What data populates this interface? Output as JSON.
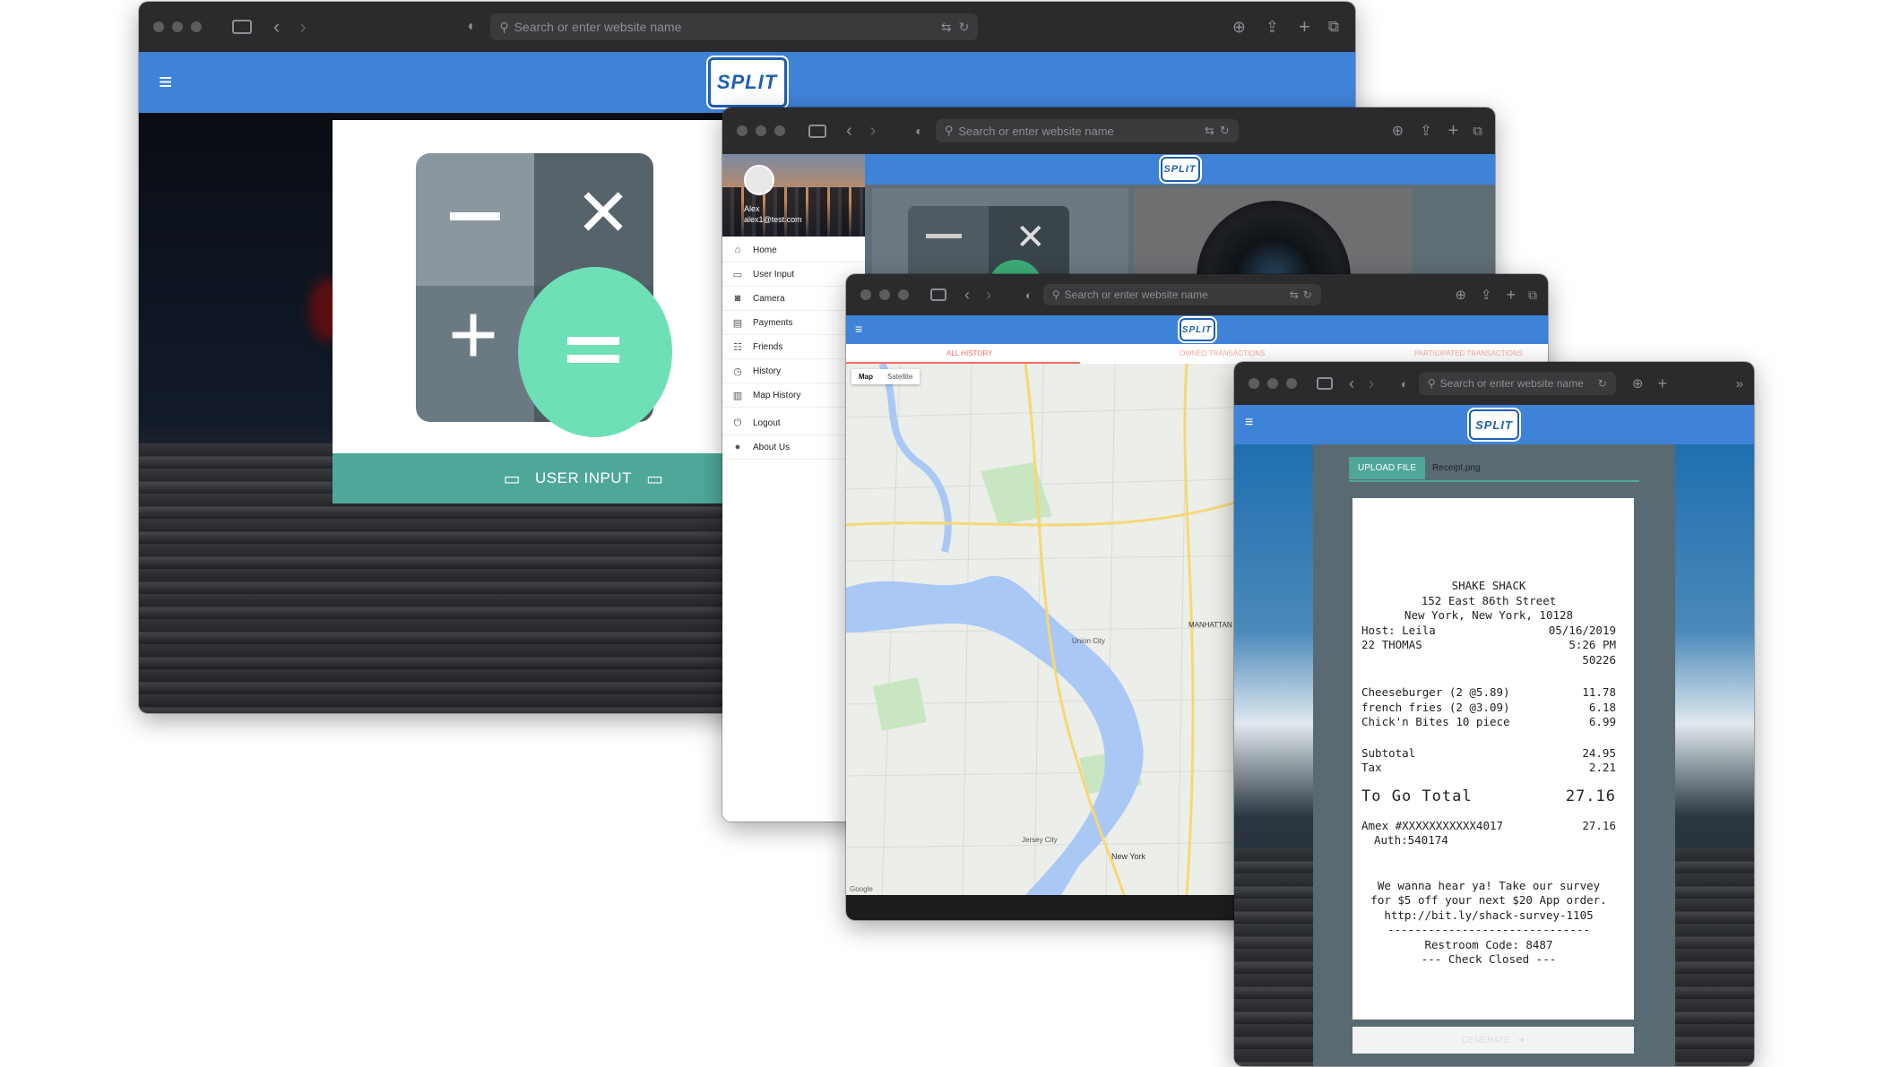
{
  "browser": {
    "url_placeholder": "Search or enter website name"
  },
  "app": {
    "logo_text": "SPLIT"
  },
  "window1": {
    "card_label": "USER INPUT",
    "card_label_icon_left": "laptop-icon",
    "card_label_icon_right": "laptop-icon",
    "calculator_icon": "calculator-icon"
  },
  "window2": {
    "profile": {
      "name": "Alex",
      "email": "alex1@test.com"
    },
    "nav": [
      {
        "label": "Home",
        "icon": "home-icon"
      },
      {
        "label": "User Input",
        "icon": "laptop-icon"
      },
      {
        "label": "Camera",
        "icon": "camera-icon"
      },
      {
        "label": "Payments",
        "icon": "payment-icon"
      },
      {
        "label": "Friends",
        "icon": "friends-icon"
      },
      {
        "label": "History",
        "icon": "history-icon"
      },
      {
        "label": "Map History",
        "icon": "map-icon"
      },
      {
        "label": "Logout",
        "icon": "power-icon"
      },
      {
        "label": "About Us",
        "icon": "info-icon"
      }
    ]
  },
  "window3": {
    "tabs": [
      "ALL HISTORY",
      "OWNED TRANSACTIONS",
      "PARTICIPATED TRANSACTIONS"
    ],
    "map_toggle": [
      "Map",
      "Satellite"
    ],
    "map_labels": [
      "Union City",
      "Jersey City",
      "New York",
      "MANHATTAN"
    ],
    "google": "Google"
  },
  "window4": {
    "upload_button": "UPLOAD FILE",
    "file_name": "Receipt.png",
    "bottom_button": "GENERATE",
    "receipt": {
      "header": [
        "SHAKE SHACK",
        "152 East 86th Street",
        "New York, New York, 10128"
      ],
      "meta": [
        [
          "Host: Leila",
          "05/16/2019"
        ],
        [
          "22 THOMAS",
          "5:26 PM"
        ],
        [
          "",
          "50226"
        ]
      ],
      "items": [
        [
          "Cheeseburger (2 @5.89)",
          "11.78"
        ],
        [
          "french fries (2 @3.09)",
          "6.18"
        ],
        [
          "Chick'n Bites 10 piece",
          "6.99"
        ]
      ],
      "subtotal": [
        "Subtotal",
        "24.95"
      ],
      "tax": [
        "Tax",
        "2.21"
      ],
      "total": [
        "To Go Total",
        "27.16"
      ],
      "card": [
        "Amex #XXXXXXXXXXX4017",
        "27.16"
      ],
      "auth": "Auth:540174",
      "footer": [
        "We wanna hear ya! Take our survey",
        "for $5 off your next $20 App order.",
        "http://bit.ly/shack-survey-1105",
        "------------------------------",
        "Restroom Code:  8487",
        "--- Check Closed ---"
      ]
    }
  },
  "colors": {
    "appbar": "#3f83d8",
    "teal": "#4fa79a",
    "mint": "#6ee0b6",
    "chrome": "#2b2b2d"
  }
}
